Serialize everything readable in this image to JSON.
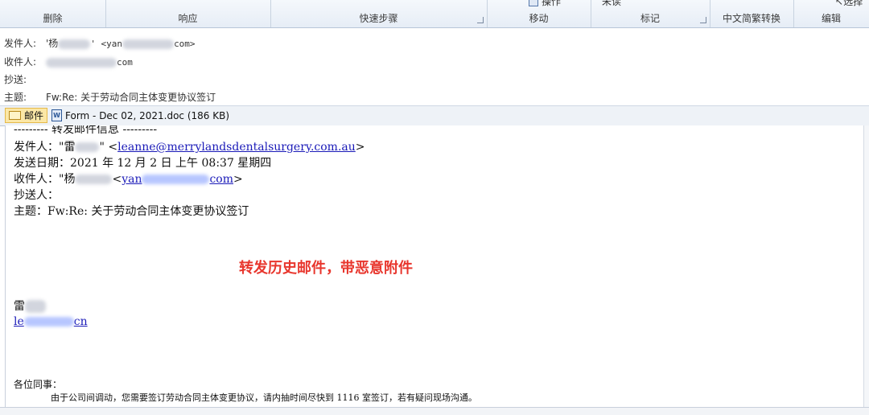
{
  "ribbon": {
    "groups": [
      {
        "label": "删除"
      },
      {
        "label": "响应"
      },
      {
        "label": "快速步骤"
      },
      {
        "label": "移动"
      },
      {
        "label": "标记"
      },
      {
        "label": "中文简繁转换"
      },
      {
        "label": "编辑"
      }
    ],
    "top_cut": {
      "move_item": "操作",
      "tag_item": "未读",
      "edit_item": "选择"
    }
  },
  "header": {
    "from_label": "发件人:",
    "from_value_prefix": "'杨",
    "from_value_suffix": "' <yan",
    "from_value_end": "com>",
    "to_label": "收件人:",
    "to_value": "com",
    "cc_label": "抄送:",
    "subject_label": "主题:",
    "subject_value": "Fw:Re: 关于劳动合同主体变更协议签订"
  },
  "attachments": {
    "message_tab": "邮件",
    "file_name": "Form - Dec 02, 2021.doc (186 KB)"
  },
  "body": {
    "forward_header": "--------- 转发邮件信息 ---------",
    "fw_from_label": "发件人：\"雷",
    "fw_from_quote": "\"",
    "fw_from_email": "leanne@merrylandsdentalsurgery.com.au",
    "fw_date": "发送日期：2021 年 12 月 2 日 上午 08:37 星期四",
    "fw_to_label": "收件人：\"杨",
    "fw_to_email_start": "yan",
    "fw_to_email_end": "com",
    "fw_cc": "抄送人：",
    "fw_subject": "主题：Fw:Re: 关于劳动合同主体变更协议签订",
    "annotation": "转发历史邮件，带恶意附件",
    "sig_name": "雷",
    "sig_link_start": "le",
    "sig_link_end": "cn",
    "greeting": "各位同事：",
    "message": "由于公司间调动，您需要签订劳动合同主体变更协议，请内抽时间尽快到 1116 室签订，若有疑问现场沟通。"
  }
}
